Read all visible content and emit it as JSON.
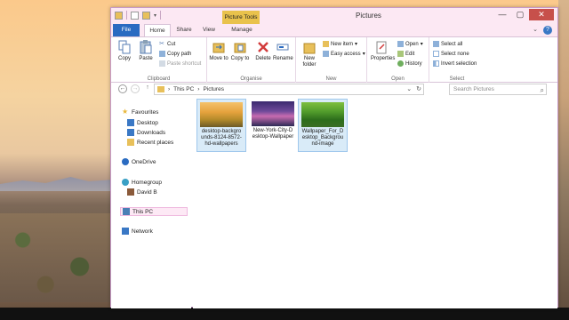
{
  "window": {
    "title": "Pictures",
    "context_tab": "Picture Tools",
    "controls": {
      "minimize": "—",
      "maximize": "▢",
      "close": "✕"
    }
  },
  "tabs": {
    "file": "File",
    "home": "Home",
    "share": "Share",
    "view": "View",
    "manage": "Manage"
  },
  "ribbon": {
    "clipboard": {
      "label": "Clipboard",
      "copy": "Copy",
      "paste": "Paste",
      "cut": "Cut",
      "copy_path": "Copy path",
      "paste_shortcut": "Paste shortcut"
    },
    "organise": {
      "label": "Organise",
      "move_to": "Move to",
      "copy_to": "Copy to",
      "delete": "Delete",
      "rename": "Rename"
    },
    "new": {
      "label": "New",
      "new_folder": "New folder",
      "new_item": "New item",
      "easy_access": "Easy access"
    },
    "open": {
      "label": "Open",
      "properties": "Properties",
      "open": "Open",
      "edit": "Edit",
      "history": "History"
    },
    "select": {
      "label": "Select",
      "select_all": "Select all",
      "select_none": "Select none",
      "invert_selection": "Invert selection"
    }
  },
  "address": {
    "back_icon": "←",
    "forward_icon": "→",
    "up_icon": "↑",
    "path": [
      "This PC",
      "Pictures"
    ],
    "separator": "›",
    "refresh_icon": "↻",
    "search_placeholder": "Search Pictures",
    "search_icon": "⌕"
  },
  "navpane": {
    "favourites": "Favourites",
    "desktop": "Desktop",
    "downloads": "Downloads",
    "recent_places": "Recent places",
    "onedrive": "OneDrive",
    "homegroup": "Homegroup",
    "david_b": "David B",
    "this_pc": "This PC",
    "network": "Network"
  },
  "files": [
    {
      "name_lines": [
        "desktop-backgro",
        "unds-8124-8572-",
        "hd-wallpapers"
      ],
      "selected": true
    },
    {
      "name_lines": [
        "New-York-City-D",
        "esktop-Wallpaper"
      ],
      "selected": false
    },
    {
      "name_lines": [
        "Wallpaper_For_D",
        "esktop_Backgrou",
        "nd-image"
      ],
      "selected": true
    }
  ],
  "colors": {
    "file_tab": "#2a6bc1",
    "context_tab": "#e9c24c",
    "title_bg": "#fce8f3",
    "close_button": "#c7504b",
    "selection_bg": "#d9ebf8"
  }
}
